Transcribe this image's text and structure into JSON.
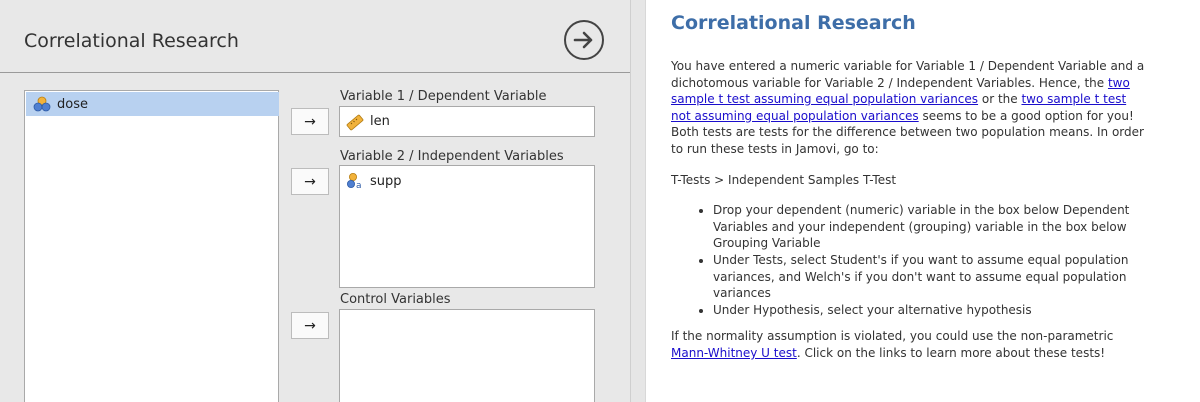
{
  "left": {
    "title": "Correlational Research",
    "source_items": [
      {
        "label": "dose",
        "icon": "nominal-variable-icon"
      }
    ],
    "var1": {
      "label": "Variable 1 / Dependent Variable",
      "items": [
        {
          "label": "len",
          "icon": "continuous-ruler-icon"
        }
      ]
    },
    "var2": {
      "label": "Variable 2 / Independent Variables",
      "items": [
        {
          "label": "supp",
          "icon": "nominal-text-variable-icon"
        }
      ]
    },
    "control": {
      "label": "Control Variables",
      "items": []
    },
    "arrow_glyph": "→"
  },
  "right": {
    "title": "Correlational Research",
    "p1_a": "You have entered a numeric variable for Variable 1 / Dependent Variable and a dichotomous variable for Variable 2 / Independent Variables. Hence, the ",
    "link1": "two sample t test assuming equal population variances",
    "p1_b": " or the ",
    "link2": "two sample t test not assuming equal population variances",
    "p1_c": " seems to be a good option for you! Both tests are tests for the difference between two population means. In order to run these tests in Jamovi, go to:",
    "path": "T-Tests > Independent Samples T-Test",
    "bullets": [
      "Drop your dependent (numeric) variable in the box below Dependent Variables and your independent (grouping) variable in the box below Grouping Variable",
      "Under Tests, select Student's if you want to assume equal population variances, and Welch's if you don't want to assume equal population variances",
      "Under Hypothesis, select your alternative hypothesis"
    ],
    "p3_a": "If the normality assumption is violated, you could use the non-parametric ",
    "link3": "Mann-Whitney U test",
    "p3_b": ". Click on the links to learn more about these tests!"
  },
  "colors": {
    "accent": "#3e6ea8",
    "link": "#1a0dcc",
    "selected": "#b8d1f0"
  }
}
